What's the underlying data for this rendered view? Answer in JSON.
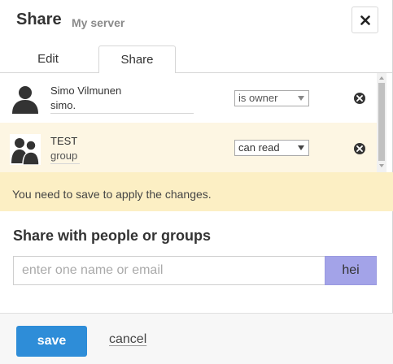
{
  "header": {
    "title": "Share",
    "subtitle": "My server",
    "close_icon": "close-icon"
  },
  "tabs": [
    {
      "label": "Edit",
      "active": false
    },
    {
      "label": "Share",
      "active": true
    }
  ],
  "members": [
    {
      "name": "Simo Vilmunen",
      "sub": "simo.",
      "role": "is owner",
      "avatar_icon": "user-icon",
      "remove_icon": "remove-icon"
    },
    {
      "name": "TEST",
      "sub": "group",
      "role": "can read",
      "avatar_icon": "group-icon",
      "remove_icon": "remove-icon",
      "highlighted": true
    }
  ],
  "notice": {
    "text": "You need to save to apply the changes.",
    "color": "#fcefc4"
  },
  "share": {
    "heading": "Share with people or groups",
    "placeholder": "enter one name or email",
    "value": "",
    "button_label": "hei",
    "button_color": "#a3a3e8"
  },
  "footer": {
    "save_label": "save",
    "cancel_label": "cancel",
    "save_color": "#2e8dd8"
  }
}
